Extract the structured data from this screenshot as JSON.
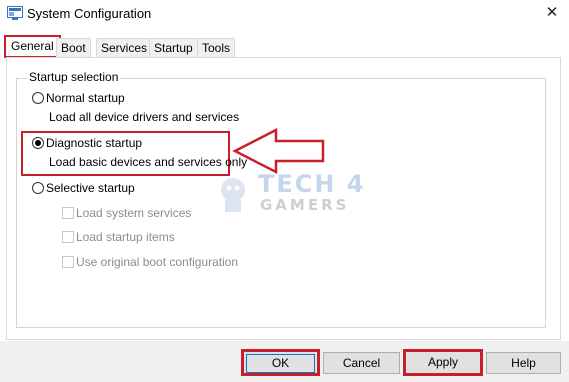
{
  "window": {
    "title": "System Configuration"
  },
  "tabs": [
    {
      "label": "General",
      "active": true
    },
    {
      "label": "Boot"
    },
    {
      "label": "Services"
    },
    {
      "label": "Startup"
    },
    {
      "label": "Tools"
    }
  ],
  "startup_selection": {
    "group_label": "Startup selection",
    "normal": {
      "label": "Normal startup",
      "description": "Load all device drivers and services",
      "checked": false
    },
    "diagnostic": {
      "label": "Diagnostic startup",
      "description": "Load basic devices and services only",
      "checked": true
    },
    "selective": {
      "label": "Selective startup",
      "checked": false,
      "options": [
        {
          "label": "Load system services",
          "checked": false,
          "enabled": false
        },
        {
          "label": "Load startup items",
          "checked": false,
          "enabled": false
        },
        {
          "label": "Use original boot configuration",
          "checked": false,
          "enabled": false
        }
      ]
    }
  },
  "buttons": {
    "ok": "OK",
    "cancel": "Cancel",
    "apply": "Apply",
    "help": "Help"
  },
  "watermark": {
    "line1": "TECH 4",
    "line2": "GAMERS"
  },
  "colors": {
    "highlight": "#c8202a",
    "button_bg": "#e1e1e1",
    "disabled_text": "#8c8c8c"
  }
}
